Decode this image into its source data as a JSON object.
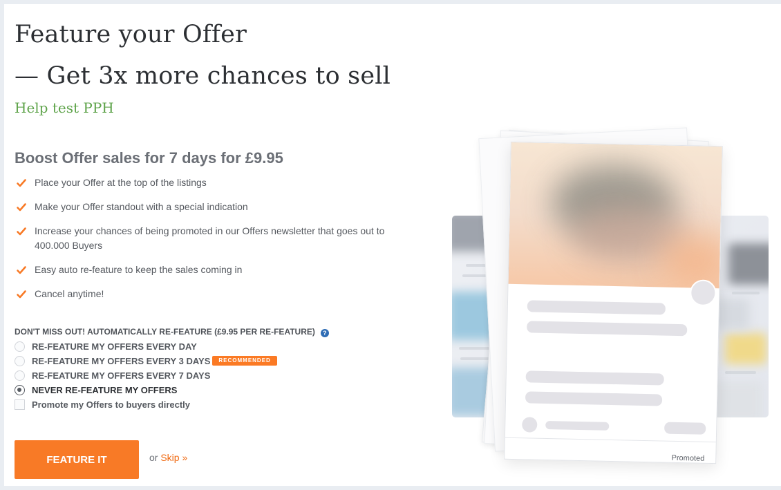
{
  "header": {
    "title_line1": "Feature your Offer",
    "title_line2": "— Get 3x more chances to sell",
    "subtitle": "Help test PPH"
  },
  "boost": {
    "heading": "Boost Offer sales for 7 days for £9.95",
    "benefits": [
      "Place your Offer at the top of the listings",
      "Make your Offer standout with a special indication",
      "Increase your chances of being promoted in our Offers newsletter that goes out to 400.000 Buyers",
      "Easy auto re-feature to keep the sales coming in",
      "Cancel anytime!"
    ]
  },
  "refeature": {
    "heading": "DON'T MISS OUT! AUTOMATICALLY RE-FEATURE (£9.95 PER RE-FEATURE)",
    "help_icon": "?",
    "options": [
      {
        "label": "RE-FEATURE MY OFFERS EVERY DAY",
        "selected": false
      },
      {
        "label": "RE-FEATURE MY OFFERS EVERY 3 DAYS",
        "selected": false,
        "badge": "RECOMMENDED"
      },
      {
        "label": "RE-FEATURE MY OFFERS EVERY 7 DAYS",
        "selected": false
      },
      {
        "label": "NEVER RE-FEATURE MY OFFERS",
        "selected": true
      }
    ],
    "promote_checkbox": {
      "label": "Promote my Offers to buyers directly",
      "checked": false
    }
  },
  "actions": {
    "feature_button": "FEATURE IT",
    "or_text": "or",
    "skip_link": "Skip »"
  },
  "illustration": {
    "card_label": "Promoted"
  },
  "colors": {
    "accent": "#f87a26",
    "subtitle_green": "#5ea34a",
    "badge_orange": "#fb7a24",
    "help_blue": "#2f6db5"
  },
  "icons": [
    "check-icon",
    "help-icon"
  ]
}
